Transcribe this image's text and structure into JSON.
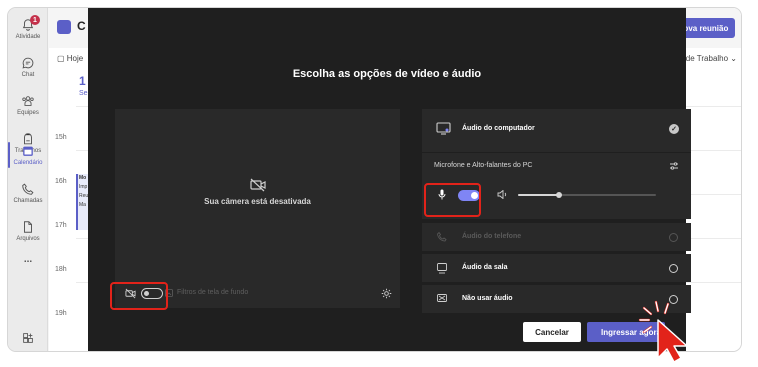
{
  "rail": {
    "items": [
      {
        "label": "Atividade"
      },
      {
        "label": "Chat"
      },
      {
        "label": "Equipes"
      },
      {
        "label": "Trabalhos"
      },
      {
        "label": "Calendário"
      },
      {
        "label": "Chamadas"
      },
      {
        "label": "Arquivos"
      },
      {
        "label": "..."
      }
    ],
    "badge": "1"
  },
  "calendar": {
    "title_fragment": "C",
    "today_label": "Hoje",
    "day_number": "1",
    "day_name": "Se",
    "hours": [
      "15h",
      "16h",
      "17h",
      "18h",
      "19h"
    ],
    "event_lines": [
      "Mo",
      "Imp",
      "Reu",
      "Ma"
    ],
    "new_meeting_label": "Nova reunião",
    "view_label": "na de Trabalho"
  },
  "modal": {
    "title": "Escolha as opções de vídeo e áudio",
    "camera_off_text": "Sua câmera está desativada",
    "background_filters_label": "Filtros de tela de fundo",
    "camera_toggle_on": false,
    "mic_toggle_on": true,
    "volume_level": 0.3,
    "audio_options": {
      "computer": "Áudio do computador",
      "device_label": "Microfone e Alto-falantes do PC",
      "phone": "Áudio do telefone",
      "room": "Áudio da sala",
      "none": "Não usar áudio"
    },
    "cancel_label": "Cancelar",
    "join_label": "Ingressar agora"
  },
  "colors": {
    "accent": "#5b5fc7",
    "highlight": "#e2231a",
    "modal_bg": "#1f1f1f",
    "panel_bg": "#292929"
  }
}
